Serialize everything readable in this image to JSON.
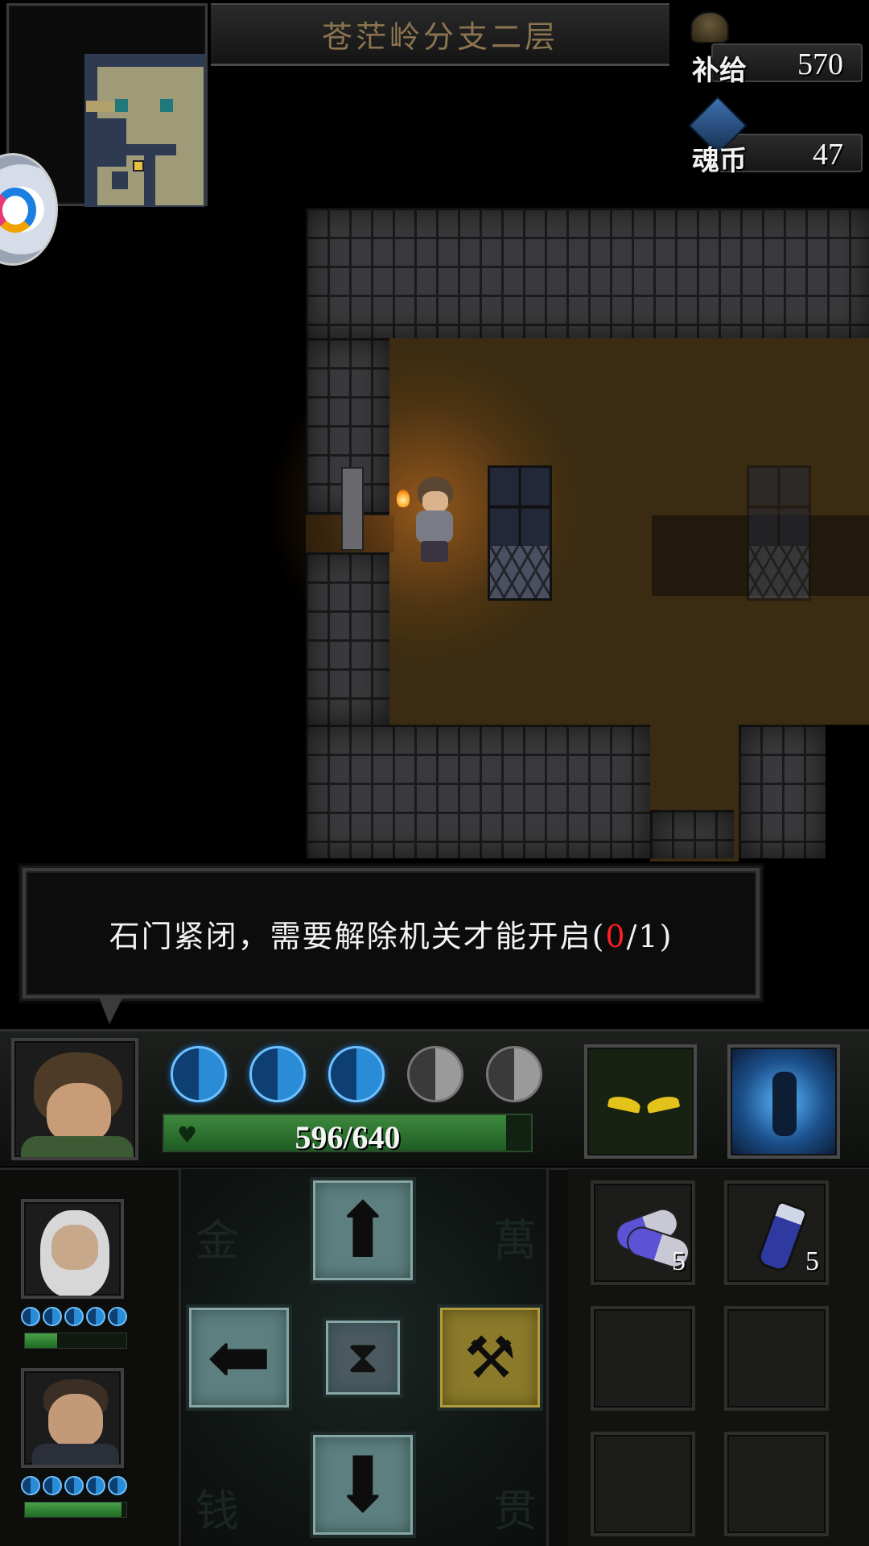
{
  "floor_title": "苍茫岭分支二层",
  "resources": {
    "supply": {
      "label": "补给",
      "value": "570",
      "icon": "supply-pot-icon"
    },
    "soul_coin": {
      "label": "魂币",
      "value": "47",
      "icon": "soul-coin-icon"
    }
  },
  "dialog": {
    "message_prefix": "石门紧闭，需要解除机关才能开启(",
    "message_current": "0",
    "message_suffix": "/1)"
  },
  "player": {
    "hp_text": "596/640",
    "hp_fraction": 0.931,
    "energy_filled": 3,
    "energy_total": 5
  },
  "skills": [
    {
      "name": "shadow-eyes-skill",
      "icon": "glowing-eyes-icon"
    },
    {
      "name": "stance-skill",
      "icon": "martial-stance-icon"
    }
  ],
  "allies": [
    {
      "name": "elder-ally",
      "hp_fraction": 0.32,
      "energy_filled": 5
    },
    {
      "name": "eyepatch-ally",
      "hp_fraction": 0.95,
      "energy_filled": 5
    }
  ],
  "controls": {
    "up": "arrow-up-icon",
    "left": "arrow-left-icon",
    "wait": "hourglass-icon",
    "dig": "shovel-icon",
    "down": "arrow-down-icon"
  },
  "inventory": [
    {
      "item": "pills-icon",
      "count": "5"
    },
    {
      "item": "potion-bottle-icon",
      "count": "5"
    },
    {
      "item": "",
      "count": ""
    },
    {
      "item": "",
      "count": ""
    },
    {
      "item": "",
      "count": ""
    },
    {
      "item": "",
      "count": ""
    }
  ],
  "colors": {
    "highlight_red": "#ff2020",
    "energy_blue": "#2a8cd6",
    "hp_green": "#3e8a3e",
    "title_gold": "#8a7450"
  }
}
